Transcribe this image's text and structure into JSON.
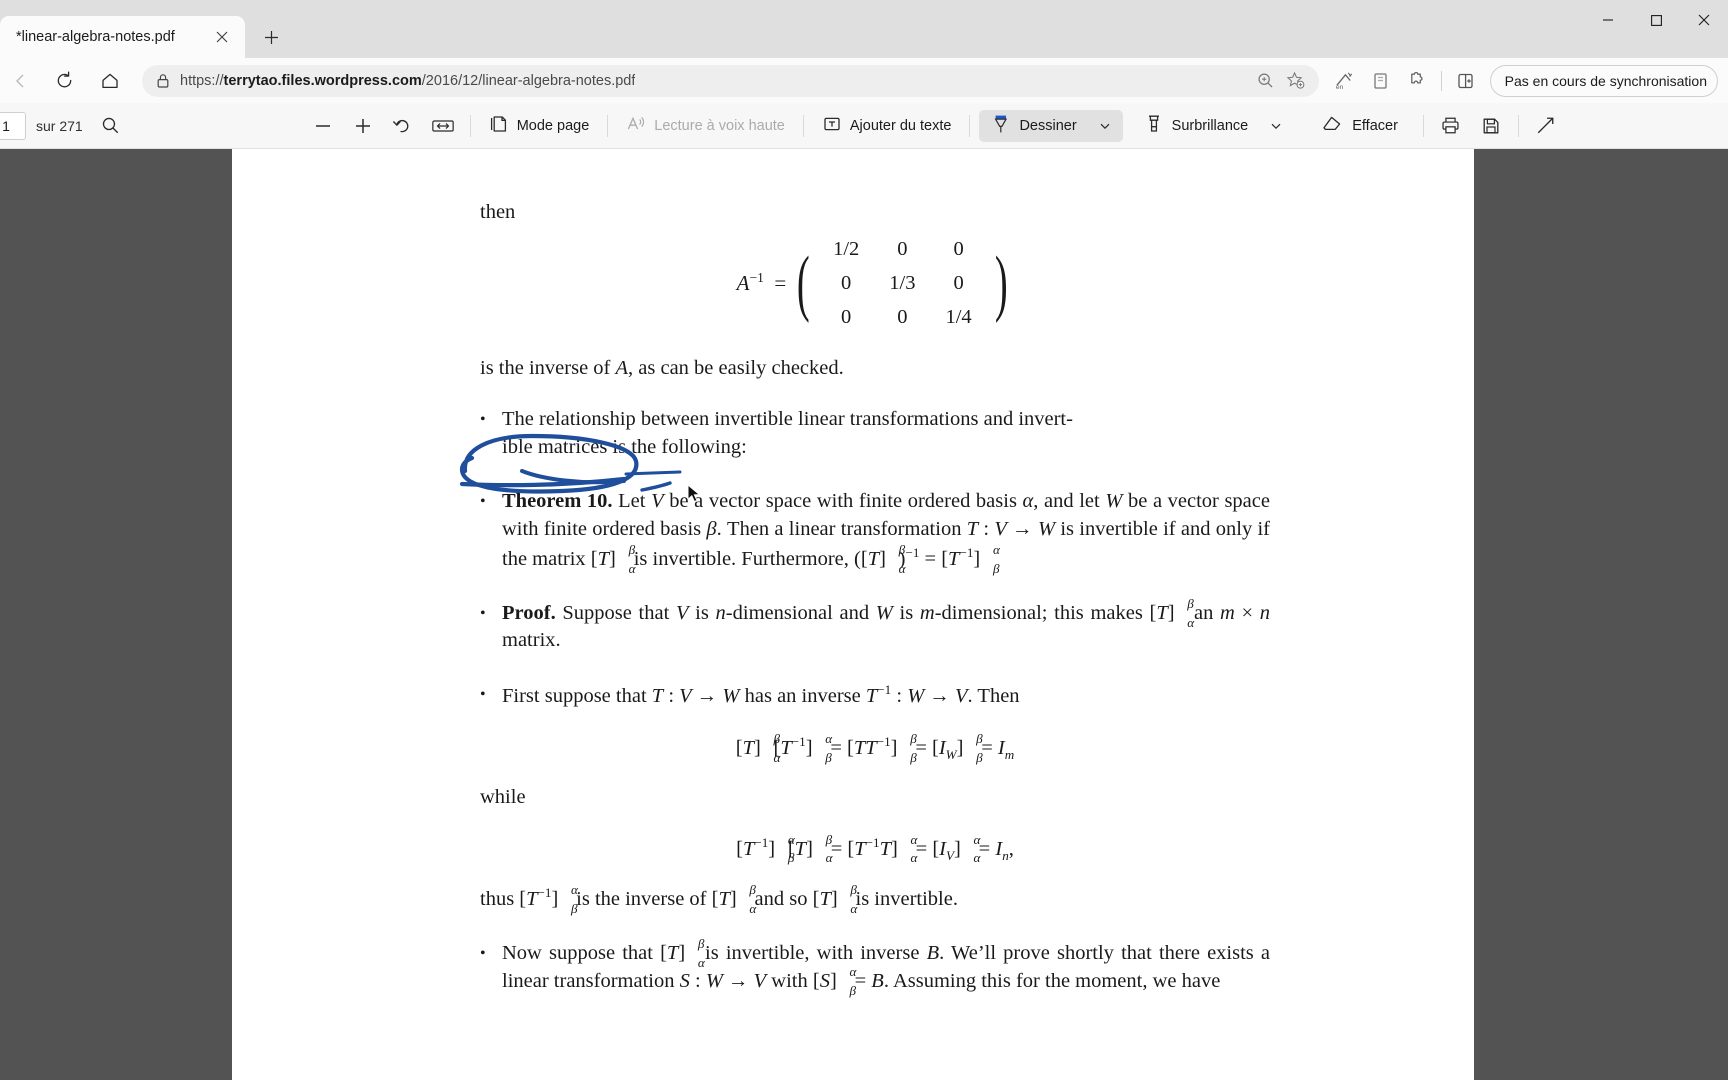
{
  "window": {
    "tab_title": "*linear-algebra-notes.pdf",
    "new_tab_label": "+",
    "minimize_label": "—",
    "maximize_label": "□",
    "close_label": "✕"
  },
  "navbar": {
    "back_icon": "back-arrow-icon",
    "refresh_icon": "refresh-icon",
    "home_icon": "home-icon",
    "lock_icon": "lock-icon",
    "url_prefix": "https://",
    "url_host": "terrytao.files.wordpress.com",
    "url_path": "/2016/12/linear-algebra-notes.pdf",
    "url_full": "https://terrytao.files.wordpress.com/2016/12/linear-algebra-notes.pdf",
    "zoom_icon": "zoom-magnifier-icon",
    "favorite_icon": "add-favorite-star-icon",
    "translate_icon": "translate-icon",
    "collections_icon": "collections-icon",
    "extensions_icon": "extensions-puzzle-icon",
    "split_screen_icon": "split-screen-icon",
    "sync_status": "Pas en cours de synchronisation",
    "profile_icon": "profile-avatar-icon"
  },
  "pdf_toolbar": {
    "page_number": "1",
    "page_total": "sur 271",
    "search_icon": "search-icon",
    "zoom_out_icon": "zoom-out-minus-icon",
    "zoom_in_icon": "zoom-in-plus-icon",
    "rotate_icon": "rotate-icon",
    "fit_icon": "fit-to-width-icon",
    "page_view_icon": "page-view-icon",
    "page_view_label": "Mode page",
    "read_aloud_icon": "read-aloud-icon",
    "read_aloud_label": "Lecture à voix haute",
    "add_text_icon": "add-text-icon",
    "add_text_label": "Ajouter du texte",
    "draw_icon": "draw-pen-icon",
    "draw_label": "Dessiner",
    "draw_caret_icon": "chevron-down-icon",
    "highlight_icon": "highlight-marker-icon",
    "highlight_label": "Surbrillance",
    "highlight_caret_icon": "chevron-down-icon",
    "erase_icon": "eraser-icon",
    "erase_label": "Effacer",
    "print_icon": "print-icon",
    "save_icon": "save-disk-icon",
    "more_icon": "more-tools-icon"
  },
  "colors": {
    "ink": "#1f4e9c",
    "accent": "#0f57b3",
    "page_bg": "#ffffff",
    "viewer_bg": "#535353",
    "toolbar_bg": "#f7f7f7",
    "titlebar_bg": "#dfdfdf"
  },
  "document": {
    "then_label": "then",
    "matrix": {
      "equals_lhs": "A",
      "exponent": "−1",
      "rows": [
        [
          "1/2",
          "0",
          "0"
        ],
        [
          "0",
          "1/3",
          "0"
        ],
        [
          "0",
          "0",
          "1/4"
        ]
      ]
    },
    "inverse_line": "is the inverse of A, as can be easily checked.",
    "bullets": [
      {
        "id": "relationship",
        "lines": [
          "The relationship between invertible linear transformations and invert-",
          "ible matrices is the following:"
        ]
      },
      {
        "id": "theorem-10",
        "label": "Theorem 10.",
        "lines": [
          "Let V be a vector space with finite ordered basis α,",
          "and let W be a vector space with finite ordered basis β. Then a linear",
          "transformation T : V → W is invertible if and only if the matrix [T]ᵅα",
          "is invertible. Furthermore, ([T]ᵅα)⁻¹ = [T⁻¹]ᵅβ"
        ]
      },
      {
        "id": "proof",
        "label": "Proof.",
        "lines": [
          "Suppose that V is n-dimensional and W is m-dimensional; this",
          "makes [T]ᵅα an m × n matrix."
        ]
      },
      {
        "id": "first-suppose",
        "lines": [
          "First suppose that T : V → W has an inverse T⁻¹ : W → V. Then"
        ]
      },
      {
        "id": "now-suppose",
        "lines": [
          "Now suppose that [T]ᵅα is invertible, with inverse B. We'll prove shortly",
          "that there exists a linear transformation S : W → V with [S]αβ = B.",
          "Assuming this for the moment, we have"
        ]
      }
    ],
    "equation_1": "[T]ᵅα[T⁻¹]αβ = [TT⁻¹]ᵅβ = [I_W]ᵅβ = I_m",
    "while_label": "while",
    "equation_2": "[T⁻¹]αβ[T]ᵅα = [T⁻¹T]αα = [I_V]αα = I_n,",
    "thus_line": "thus [T⁻¹]αβ is the inverse of [T]ᵅα and so [T]ᵅα is invertible."
  },
  "annotation": {
    "type": "ink-drawing",
    "description": "blue hand-drawn ellipse circling 'Theorem 10.' with underline strokes",
    "color": "#1f4e9c",
    "stroke_width": 4
  }
}
